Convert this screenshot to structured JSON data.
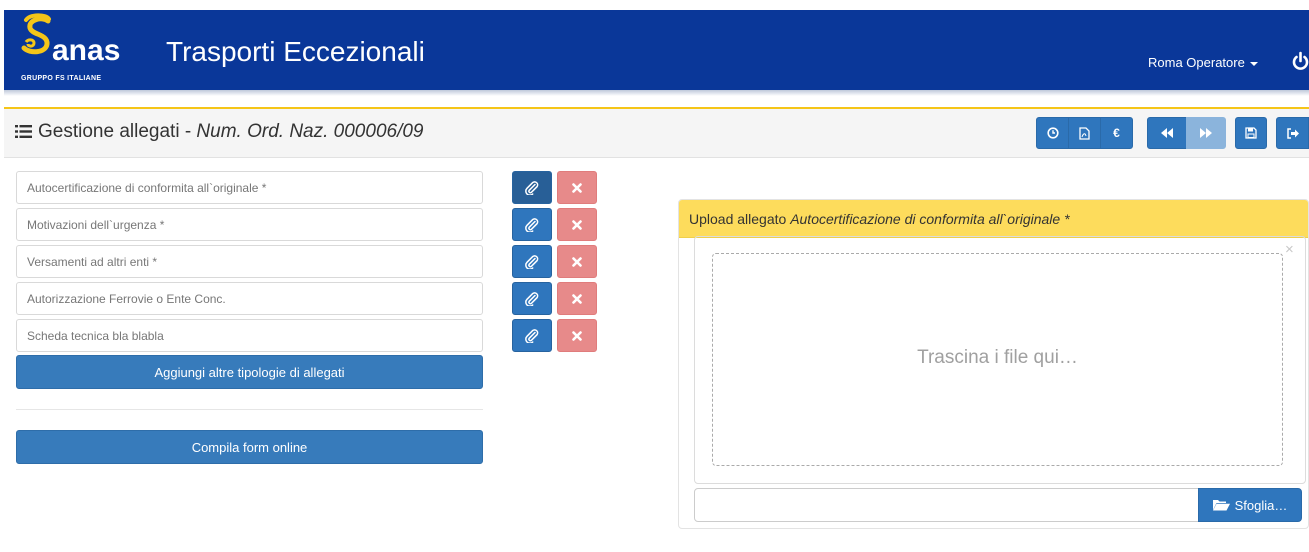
{
  "header": {
    "logo_word": "anas",
    "logo_sub": "GRUPPO FS ITALIANE",
    "app_title": "Trasporti Eccezionali",
    "user_label": "Roma Operatore",
    "icon": "power-icon",
    "bg_color": "#0a3799"
  },
  "section": {
    "title": "Gestione allegati - ",
    "subtitle": "Num. Ord. Naz. 000006/09",
    "icon": "list-icon",
    "accent_color": "#f5c518"
  },
  "toolbar": {
    "buttons": [
      {
        "icon": "clock-icon"
      },
      {
        "icon": "pdf-icon"
      },
      {
        "icon": "euro-icon",
        "label": "€"
      },
      {
        "icon": "backward-icon"
      },
      {
        "icon": "forward-icon"
      },
      {
        "icon": "save-icon"
      },
      {
        "icon": "exit-icon"
      }
    ]
  },
  "attachments": {
    "items": [
      {
        "label": "Autocertificazione di conformita all`originale *"
      },
      {
        "label": "Motivazioni dell`urgenza *"
      },
      {
        "label": "Versamenti ad altri enti *"
      },
      {
        "label": "Autorizzazione Ferrovie o Ente Conc."
      },
      {
        "label": "Scheda tecnica bla blabla"
      }
    ],
    "add_button": "Aggiungi altre tipologie di allegati",
    "online_form_button": "Compila form online",
    "attach_icon": "paperclip-icon",
    "remove_icon": "close-icon",
    "remove_color": "#e78a8a"
  },
  "upload": {
    "heading": "Upload allegato ",
    "heading_doc": "Autocertificazione di conformita all`originale *",
    "close_glyph": "×",
    "drop_text": "Trascina i file qui…",
    "browse_label": "Sfoglia…",
    "browse_icon": "folder-open-icon",
    "head_color": "#fddc5c"
  }
}
